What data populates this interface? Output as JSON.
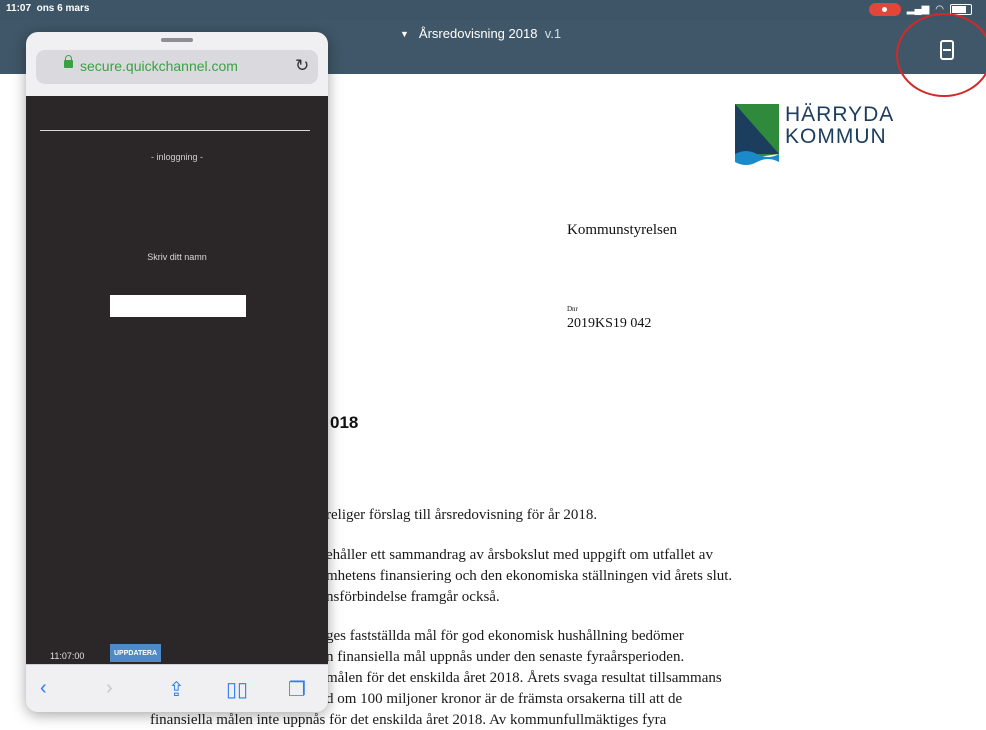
{
  "status_bar": {
    "time": "11:07",
    "date": "ons 6 mars",
    "signal": "⁠.ıll",
    "wifi": "wifi-icon",
    "battery_level": 0.8
  },
  "toolbar": {
    "document_title": "Årsredovisning 2018",
    "version": "v.1"
  },
  "logo": {
    "line1": "HÄRRYDA",
    "line2": "KOMMUN",
    "colors": {
      "green": "#2f8a3c",
      "navy": "#1b3d5e"
    }
  },
  "document": {
    "department": "Kommunstyrelsen",
    "dnr_label": "Dnr",
    "dnr_value": "2019KS19  042",
    "heading_fragment": "018",
    "paragraph1": "religer förslag till årsredovisning för år 2018.",
    "paragraph2": [
      "ehåller ett sammandrag av årsbokslut med uppgift om utfallet av",
      "mhetens finansiering och den ekonomiska ställningen vid årets slut.",
      "nsförbindelse framgår också."
    ],
    "paragraph3": [
      "ges fastställda mål för god ekonomisk hushållning bedömer",
      "n finansiella mål uppnås under den senaste fyraårsperioden.",
      "målen för det enskilda året 2018. Årets svaga resultat tillsammans",
      "d om 100 miljoner kronor är de främsta orsakerna till att de",
      "finansiella målen inte uppnås för det enskilda året 2018. Av kommunfullmäktiges fyra"
    ]
  },
  "popup": {
    "url": "secure.quickchannel.com",
    "login_heading": "- inloggning -",
    "name_prompt": "Skriv ditt namn",
    "name_value": "",
    "clock": "11:07:00",
    "update_label": "UPPDATERA"
  },
  "colors": {
    "toolbar": "#3f5768",
    "link_green": "#3aa143",
    "ios_blue": "#2e7cf6",
    "annotation_red": "#d12a2a"
  }
}
